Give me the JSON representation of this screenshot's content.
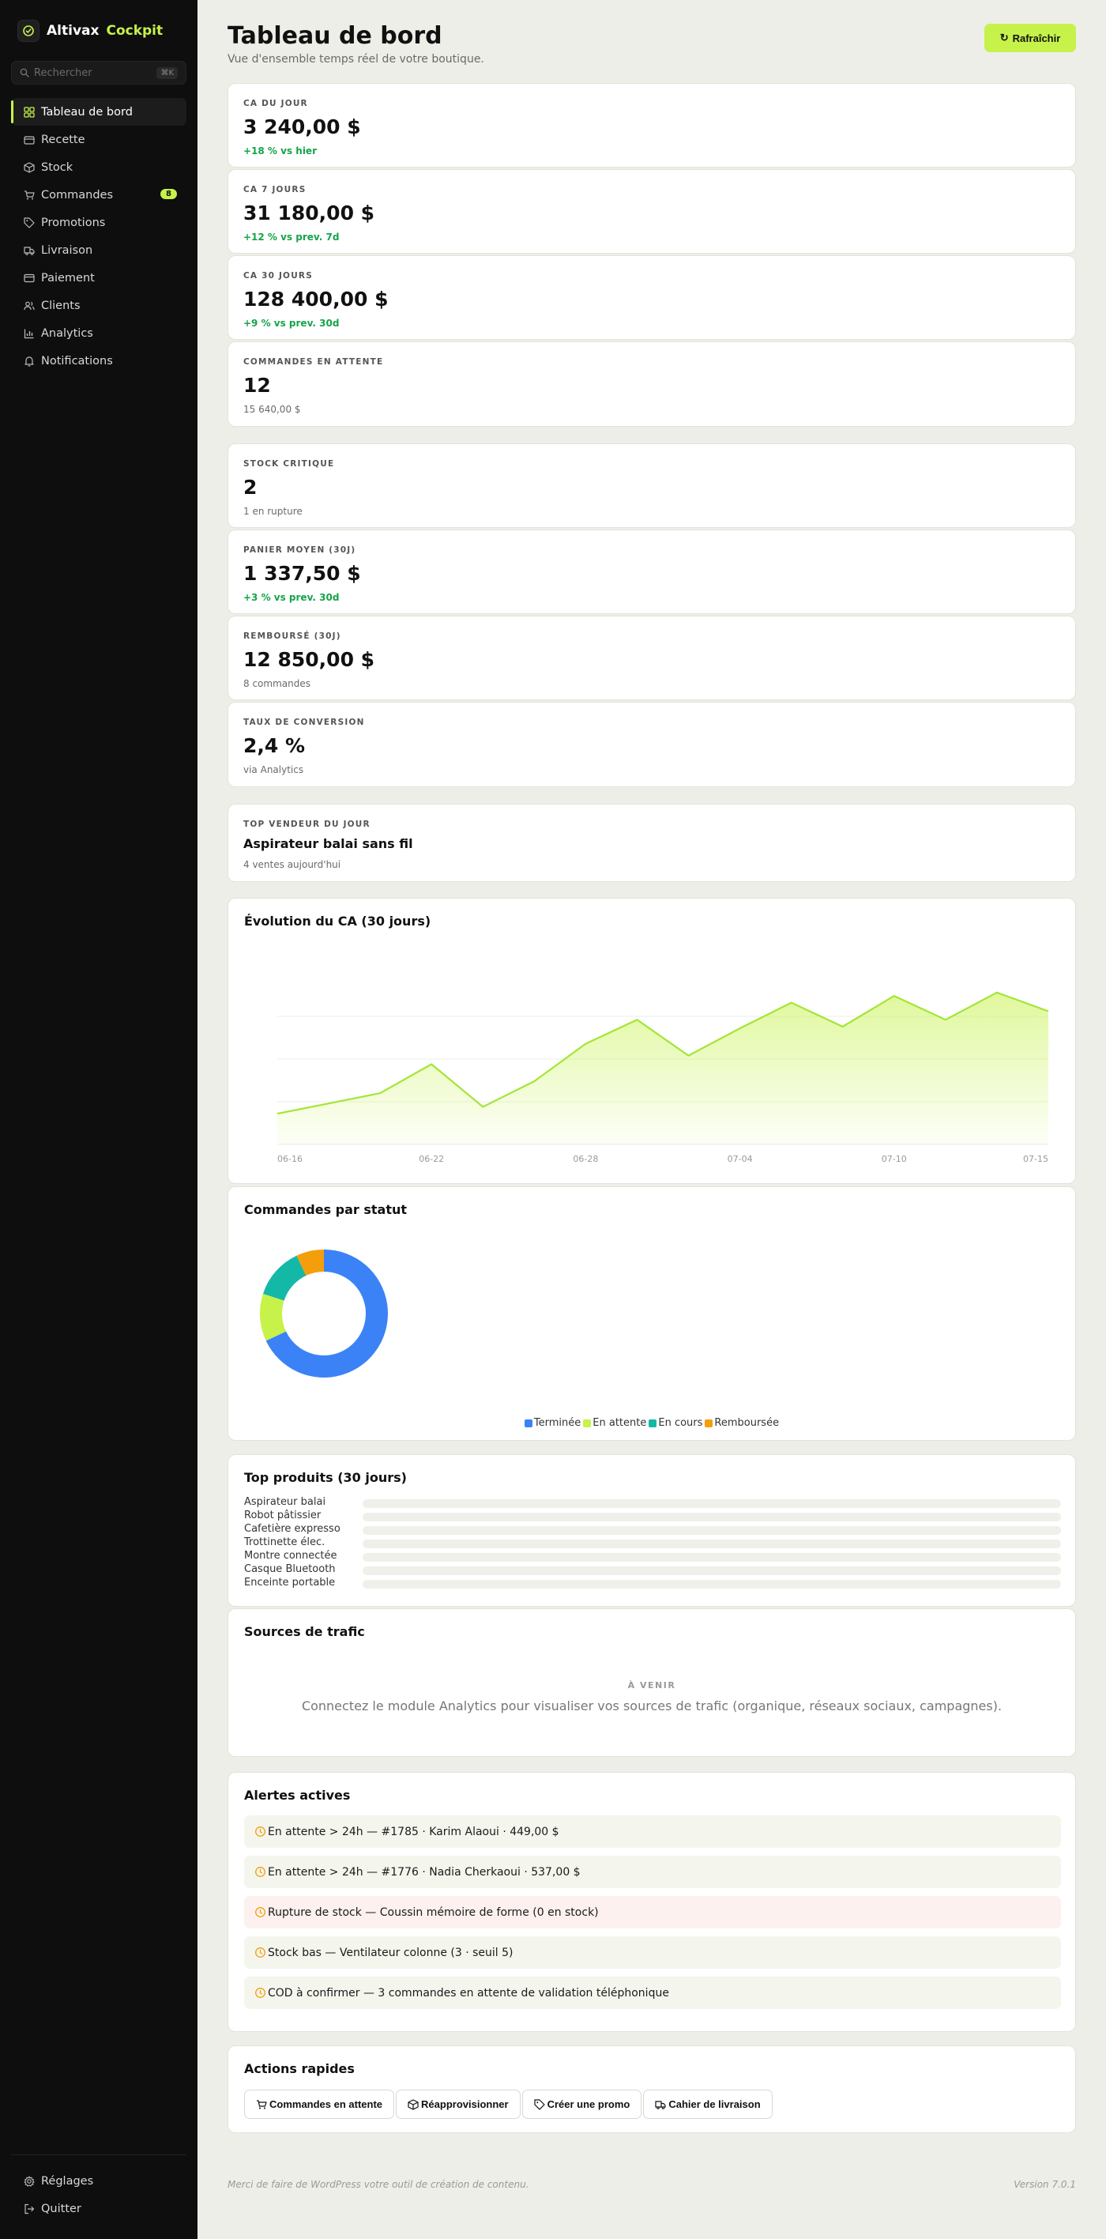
{
  "app": {
    "brand_name": "Altivax",
    "brand_accent": "Cockpit"
  },
  "search": {
    "placeholder": "Rechercher",
    "shortcut": "⌘K"
  },
  "sidebar": {
    "items": [
      {
        "label": "Tableau de bord",
        "icon": "grid-icon",
        "active": true
      },
      {
        "label": "Recette",
        "icon": "wallet-icon"
      },
      {
        "label": "Stock",
        "icon": "box-icon"
      },
      {
        "label": "Commandes",
        "icon": "cart-icon",
        "badge": "8"
      },
      {
        "label": "Promotions",
        "icon": "tag-icon"
      },
      {
        "label": "Livraison",
        "icon": "truck-icon"
      },
      {
        "label": "Paiement",
        "icon": "card-icon"
      },
      {
        "label": "Clients",
        "icon": "users-icon"
      },
      {
        "label": "Analytics",
        "icon": "chart-icon"
      },
      {
        "label": "Notifications",
        "icon": "bell-icon"
      }
    ],
    "bottom": [
      {
        "label": "Réglages",
        "icon": "gear-icon"
      },
      {
        "label": "Quitter",
        "icon": "logout-icon"
      }
    ]
  },
  "header": {
    "title": "Tableau de bord",
    "subtitle": "Vue d'ensemble temps réel de votre boutique.",
    "refresh_label": "Rafraîchir"
  },
  "kpis": [
    {
      "label": "CA du jour",
      "value": "3 240,00 $",
      "delta": "+18 % vs hier"
    },
    {
      "label": "CA 7 jours",
      "value": "31 180,00 $",
      "delta": "+12 % vs prev. 7d"
    },
    {
      "label": "CA 30 jours",
      "value": "128 400,00 $",
      "delta": "+9 % vs prev. 30d"
    },
    {
      "label": "Commandes en attente",
      "value": "12",
      "note": "15 640,00 $"
    },
    {
      "label": "Stock critique",
      "value": "2",
      "note": "1 en rupture"
    },
    {
      "label": "Panier moyen (30j)",
      "value": "1 337,50 $",
      "delta": "+3 % vs prev. 30d"
    },
    {
      "label": "Remboursé (30j)",
      "value": "12 850,00 $",
      "note": "8 commandes"
    },
    {
      "label": "Taux de conversion",
      "value": "2,4 %",
      "note": "via Analytics"
    }
  ],
  "top_seller": {
    "label": "Top vendeur du jour",
    "name": "Aspirateur balai sans fil",
    "note": "4 ventes aujourd'hui"
  },
  "revenue_chart": {
    "title": "Évolution du CA (30 jours)"
  },
  "status_chart": {
    "title": "Commandes par statut"
  },
  "products": {
    "title": "Top produits (30 jours)"
  },
  "traffic": {
    "title": "Sources de trafic",
    "tag": "À venir",
    "text": "Connectez le module Analytics pour visualiser vos sources de trafic (organique, réseaux sociaux, campagnes)."
  },
  "alerts": {
    "title": "Alertes actives",
    "items": [
      {
        "text": "En attente > 24h — #1785 · Karim Alaoui · 449,00 $",
        "level": "warning"
      },
      {
        "text": "En attente > 24h — #1776 · Nadia Cherkaoui · 537,00 $",
        "level": "warning"
      },
      {
        "text": "Rupture de stock — Coussin mémoire de forme (0 en stock)",
        "level": "danger"
      },
      {
        "text": "Stock bas — Ventilateur colonne (3 · seuil 5)",
        "level": "warning"
      },
      {
        "text": "COD à confirmer — 3 commandes en attente de validation téléphonique",
        "level": "warning"
      }
    ]
  },
  "quick_actions": {
    "title": "Actions rapides",
    "items": [
      {
        "label": "Commandes en attente",
        "icon": "cart-icon"
      },
      {
        "label": "Réapprovisionner",
        "icon": "box-icon"
      },
      {
        "label": "Créer une promo",
        "icon": "tag-icon"
      },
      {
        "label": "Cahier de livraison",
        "icon": "truck-icon"
      }
    ]
  },
  "footer": {
    "left": "Merci de faire de WordPress votre outil de création de contenu.",
    "right": "Version 7.0.1"
  },
  "colors": {
    "accent": "#c6f24a",
    "sidebar_bg": "#0e0e0e",
    "positive": "#16a34a",
    "alert_icon": "#f59e0b"
  },
  "chart_data": [
    {
      "type": "area",
      "title": "Évolution du CA (30 jours)",
      "x_ticks": [
        "06-16",
        "06-22",
        "06-28",
        "07-04",
        "07-10",
        "07-15"
      ],
      "x": [
        "06-16",
        "06-18",
        "06-20",
        "06-22",
        "06-24",
        "06-26",
        "06-28",
        "06-30",
        "07-02",
        "07-04",
        "07-06",
        "07-08",
        "07-10",
        "07-12",
        "07-14",
        "07-15"
      ],
      "y": [
        0.18,
        0.24,
        0.3,
        0.47,
        0.22,
        0.37,
        0.59,
        0.73,
        0.52,
        0.68,
        0.83,
        0.69,
        0.87,
        0.73,
        0.89,
        0.78
      ],
      "ylim": [
        0,
        1
      ],
      "grid": true,
      "color": "#a3e635"
    },
    {
      "type": "pie",
      "title": "Commandes par statut",
      "donut": true,
      "categories": [
        "Terminée",
        "En attente",
        "En cours",
        "Remboursée"
      ],
      "values": [
        68,
        12,
        13,
        7
      ],
      "colors": [
        "#3b82f6",
        "#c6f24a",
        "#14b8a6",
        "#f59e0b"
      ],
      "legend": "bottom"
    },
    {
      "type": "bar",
      "orientation": "horizontal",
      "title": "Top produits (30 jours)",
      "categories": [
        "Aspirateur balai",
        "Robot pâtissier",
        "Cafetière expresso",
        "Trottinette élec.",
        "Montre connectée",
        "Casque Bluetooth",
        "Enceinte portable"
      ],
      "values": [
        0,
        0,
        0,
        0,
        0,
        0,
        0
      ]
    }
  ]
}
